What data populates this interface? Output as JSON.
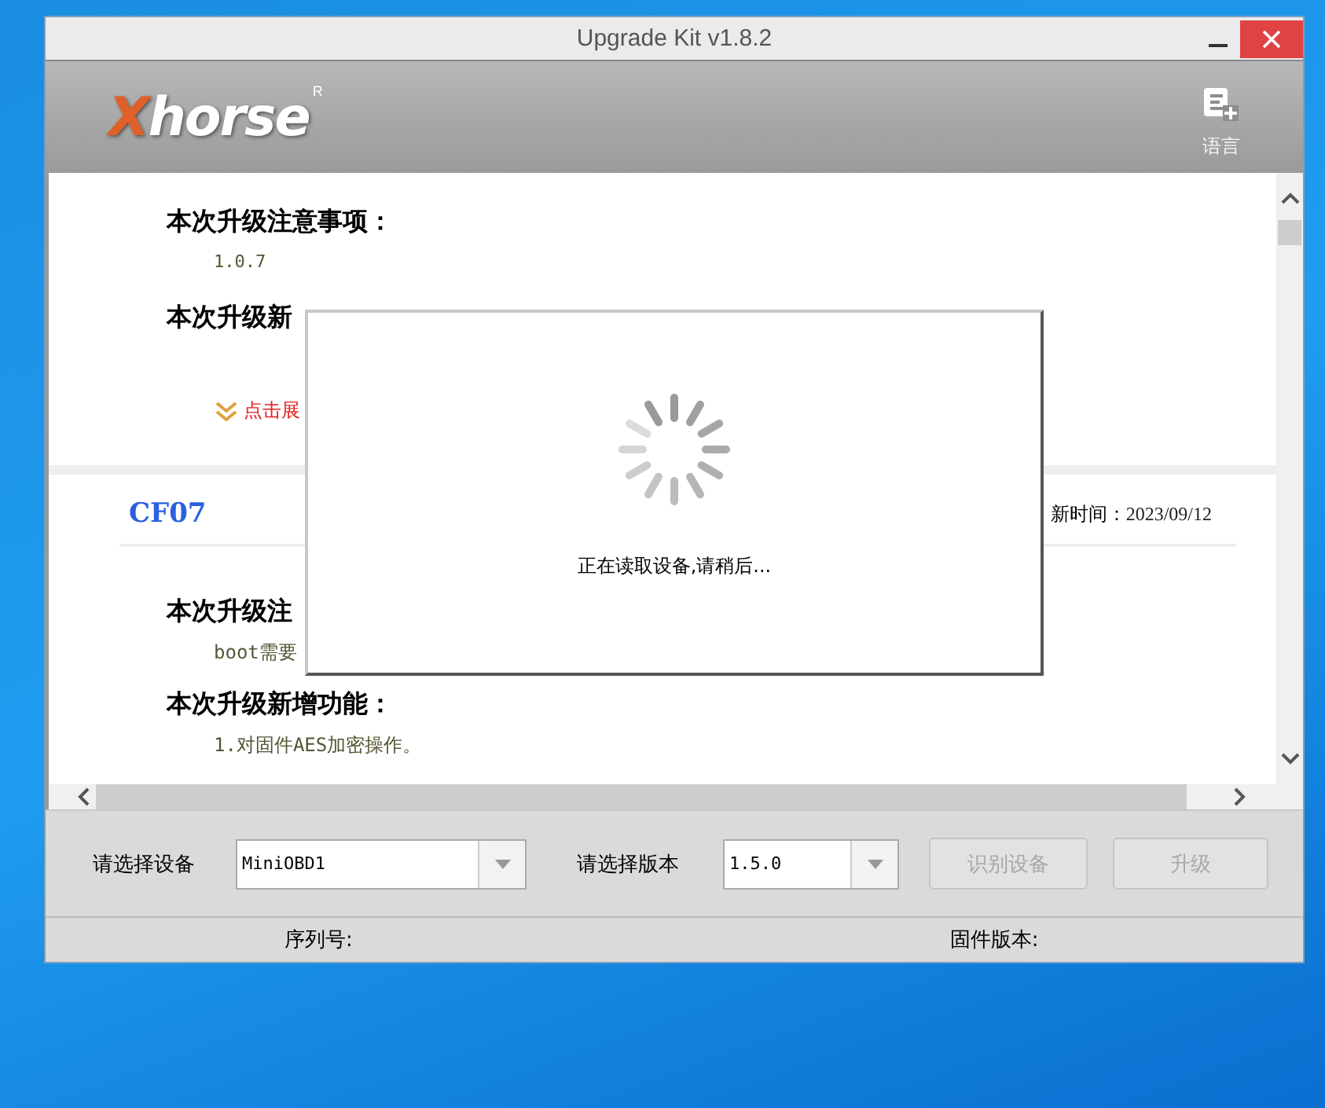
{
  "window": {
    "title": "Upgrade Kit v1.8.2"
  },
  "header": {
    "logo": "Xhorse",
    "logo_mark": "R",
    "language_button": "语言"
  },
  "sections": [
    {
      "notes_heading": "本次升级注意事项：",
      "notes": "1.0.7",
      "features_heading": "本次升级新",
      "expand_link": "点击展"
    },
    {
      "name": "CF07",
      "update_label": "新时间：",
      "update_date": "2023/09/12",
      "notes_heading": "本次升级注",
      "notes": "boot需要",
      "features_heading": "本次升级新增功能：",
      "features": "1.对固件AES加密操作。"
    }
  ],
  "loading_dialog": {
    "message": "正在读取设备,请稍后..."
  },
  "controls": {
    "device_label": "请选择设备",
    "device_value": "MiniOBD1",
    "version_label": "请选择版本",
    "version_value": "1.5.0",
    "buttons": [
      {
        "label": "识别设备",
        "disabled": true
      },
      {
        "label": "升级",
        "disabled": true
      }
    ]
  },
  "status_bar": {
    "serial_label": "序列号:",
    "firmware_label": "固件版本:"
  }
}
